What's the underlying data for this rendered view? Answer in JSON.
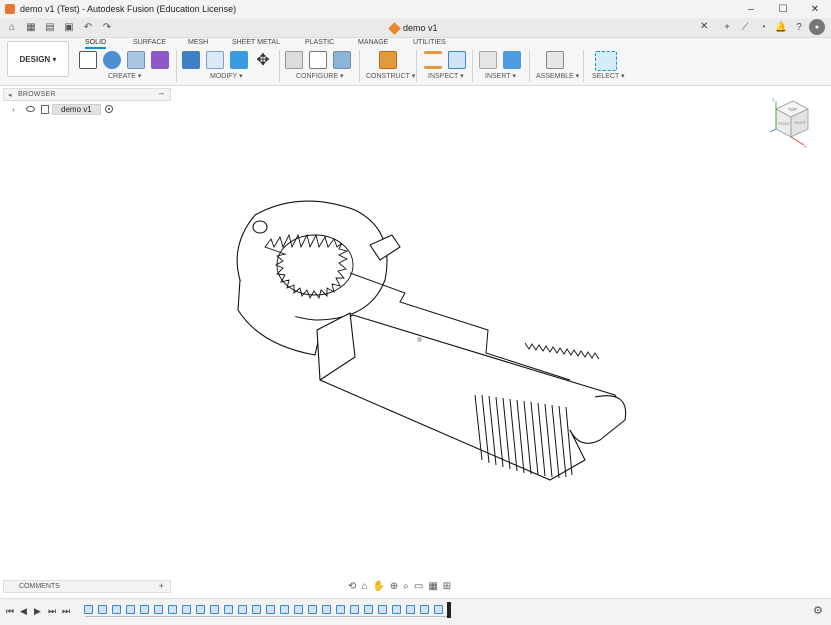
{
  "window": {
    "title": "demo v1 (Test) - Autodesk Fusion (Education License)",
    "controls": [
      "–",
      "☐",
      "✕"
    ]
  },
  "document": {
    "tab_name": "demo v1"
  },
  "toolbar": {
    "workspace": "DESIGN ▾",
    "tabs": [
      "SOLID",
      "SURFACE",
      "MESH",
      "SHEET METAL",
      "PLASTIC",
      "MANAGE",
      "UTILITIES"
    ],
    "active_tab": "SOLID",
    "groups": [
      {
        "label": "CREATE ▾"
      },
      {
        "label": "MODIFY ▾"
      },
      {
        "label": "CONFIGURE ▾"
      },
      {
        "label": "CONSTRUCT ▾"
      },
      {
        "label": "INSPECT ▾"
      },
      {
        "label": "INSERT ▾"
      },
      {
        "label": "ASSEMBLE ▾"
      },
      {
        "label": "SELECT ▾"
      }
    ]
  },
  "browser": {
    "title": "BROWSER",
    "root_item": "demo v1"
  },
  "viewcube": {
    "face_top": "TOP",
    "face_front": "FRONT",
    "face_right": "RIGHT"
  },
  "comments": {
    "title": "COMMENTS"
  },
  "colors": {
    "accent": "#0696d7",
    "timeline_feature": "#3b87c9",
    "logo": "#e8762d"
  }
}
